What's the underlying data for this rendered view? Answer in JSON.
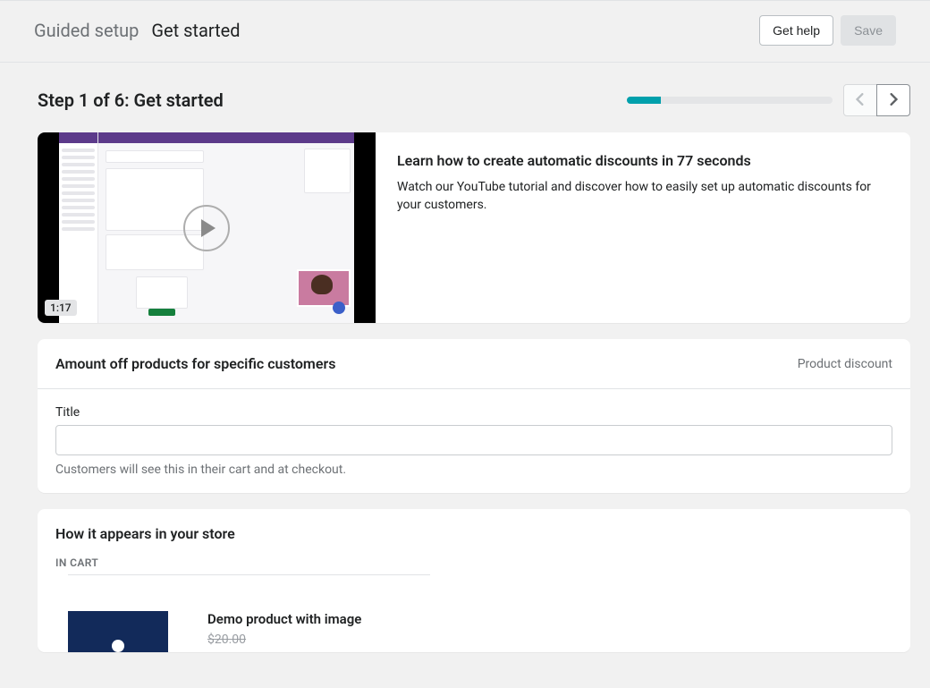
{
  "header": {
    "breadcrumb_root": "Guided setup",
    "breadcrumb_current": "Get started",
    "help_label": "Get help",
    "save_label": "Save"
  },
  "step": {
    "title": "Step 1 of 6: Get started",
    "current": 1,
    "total": 6
  },
  "video": {
    "duration": "1:17",
    "title": "Learn how to create automatic discounts in 77 seconds",
    "description": "Watch our YouTube tutorial and discover how to easily set up automatic discounts for your customers."
  },
  "form": {
    "heading": "Amount off products for specific customers",
    "tag": "Product discount",
    "title_label": "Title",
    "title_value": "",
    "title_help": "Customers will see this in their cart and at checkout."
  },
  "preview": {
    "heading": "How it appears in your store",
    "group_label": "IN CART",
    "product_name": "Demo product with image",
    "original_price": "$20.00"
  }
}
